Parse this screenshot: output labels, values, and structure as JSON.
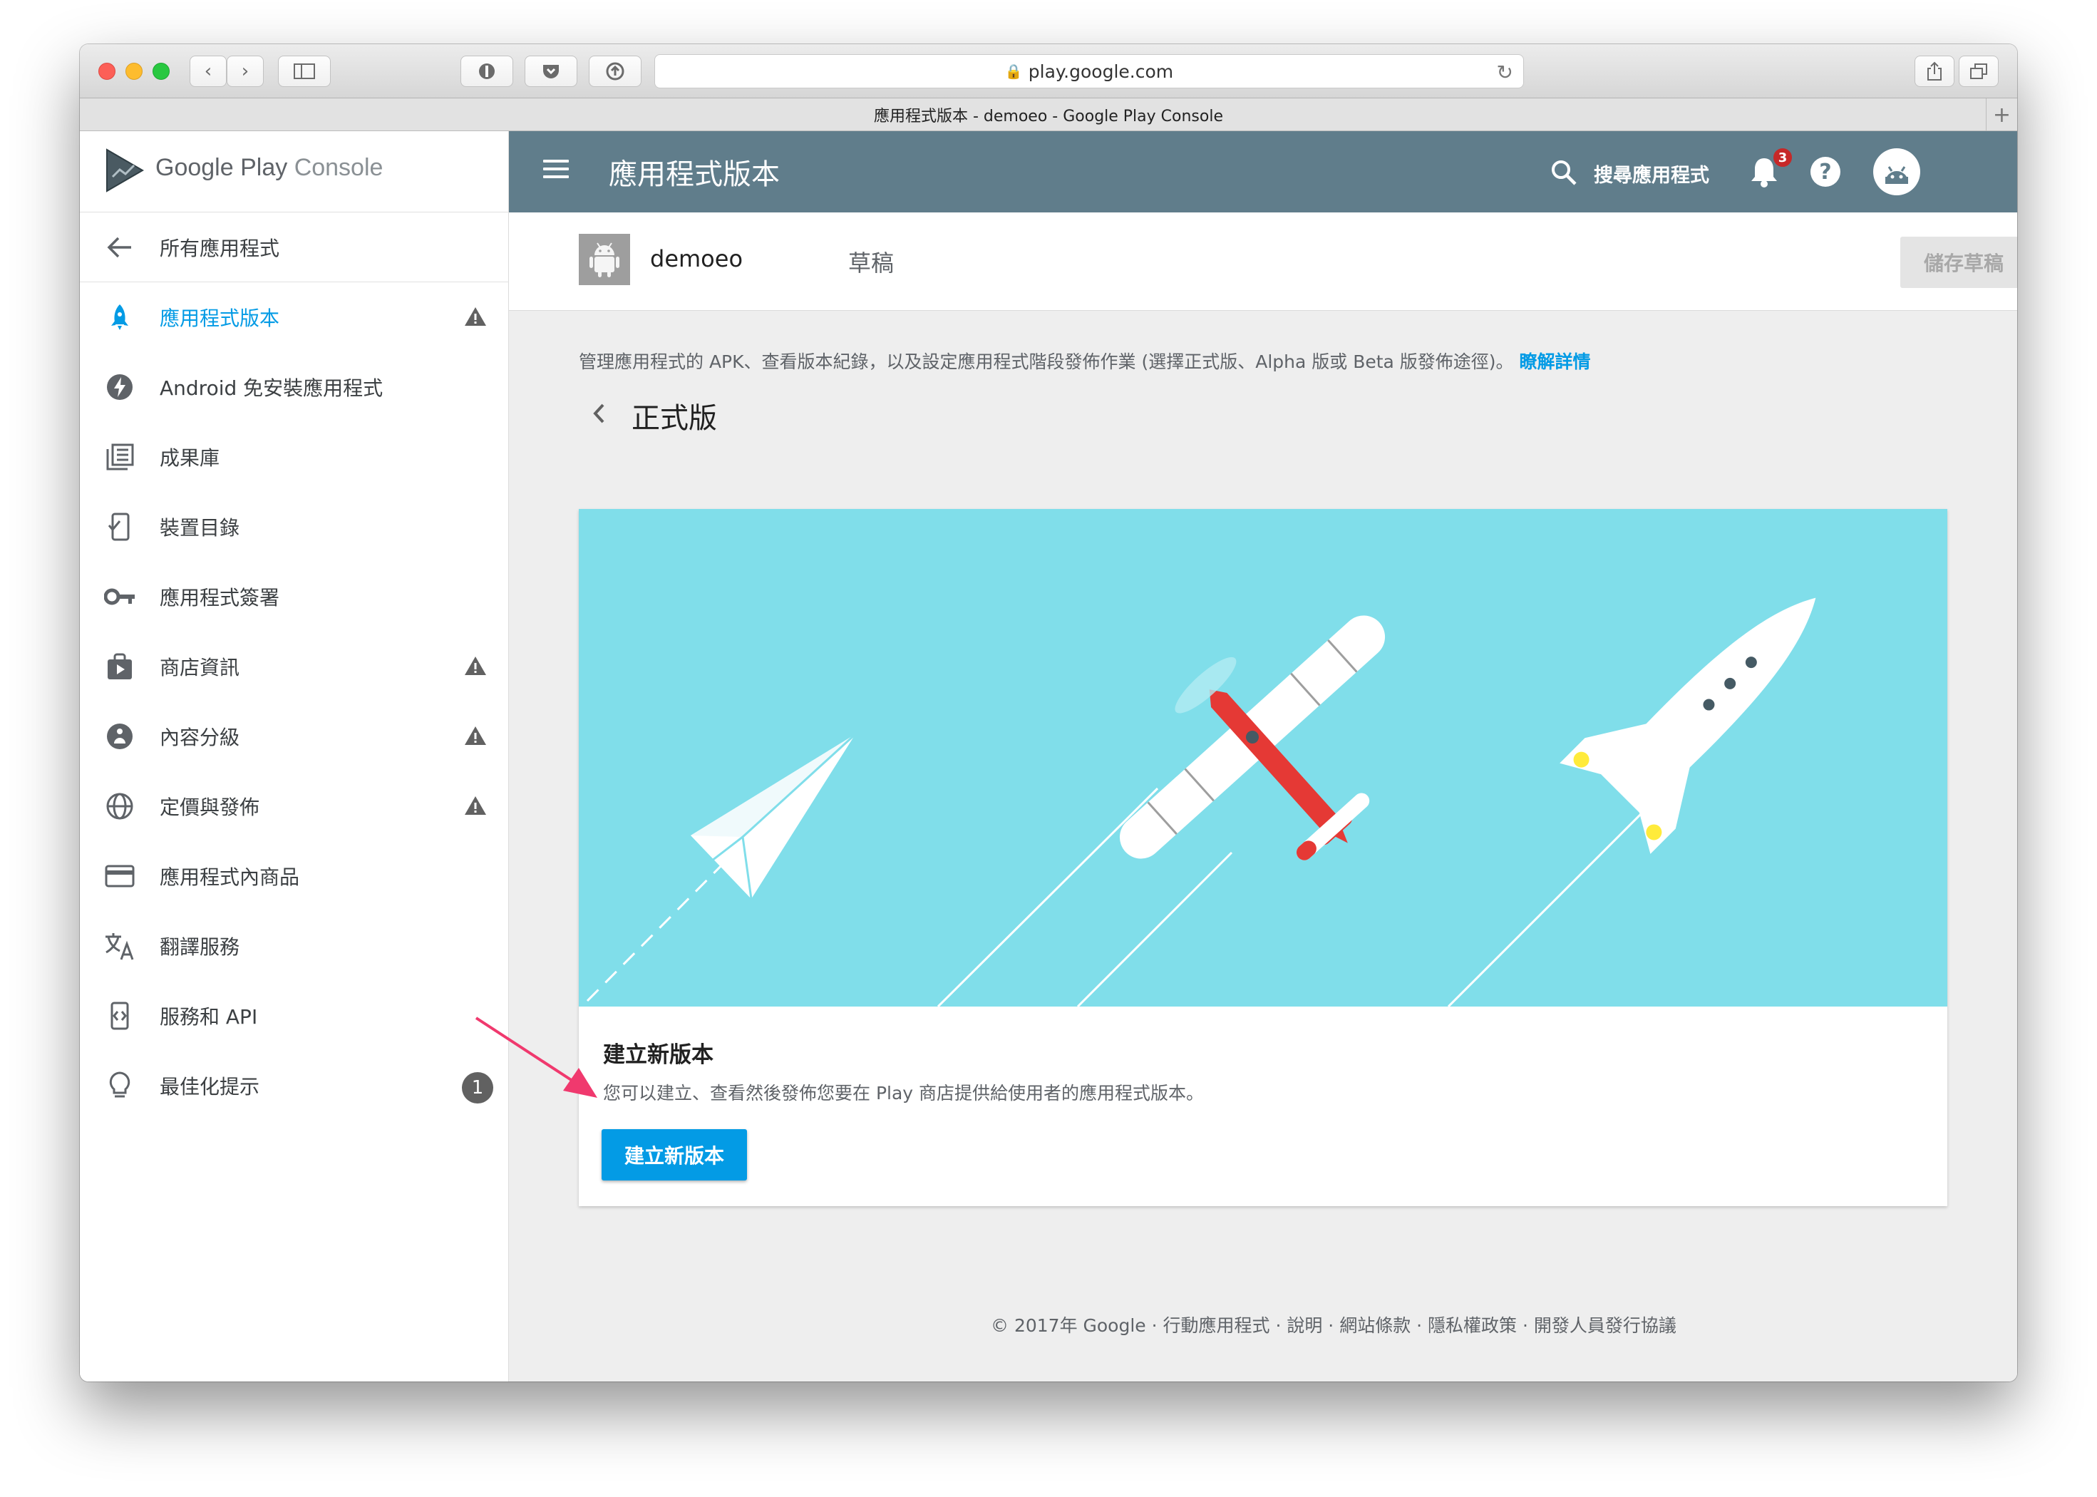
{
  "browser": {
    "url": "play.google.com",
    "tab_title": "應用程式版本 - demoeo - Google Play Console"
  },
  "sidebar": {
    "brand": {
      "name": "Google Play",
      "product": "Console"
    },
    "back_label": "所有應用程式",
    "items": [
      {
        "label": "應用程式版本",
        "icon": "rocket-icon",
        "active": true,
        "warning": true
      },
      {
        "label": "Android 免安裝應用程式",
        "icon": "lightning-icon",
        "warning": false
      },
      {
        "label": "成果庫",
        "icon": "library-icon",
        "warning": false
      },
      {
        "label": "裝置目錄",
        "icon": "device-catalog-icon",
        "warning": false
      },
      {
        "label": "應用程式簽署",
        "icon": "key-icon",
        "warning": false
      },
      {
        "label": "商店資訊",
        "icon": "store-listing-icon",
        "warning": true
      },
      {
        "label": "內容分級",
        "icon": "content-rating-icon",
        "warning": true
      },
      {
        "label": "定價與發佈",
        "icon": "globe-icon",
        "warning": true
      },
      {
        "label": "應用程式內商品",
        "icon": "credit-card-icon",
        "warning": false
      },
      {
        "label": "翻譯服務",
        "icon": "translate-icon",
        "warning": false
      },
      {
        "label": "服務和 API",
        "icon": "api-icon",
        "warning": false
      },
      {
        "label": "最佳化提示",
        "icon": "lightbulb-icon",
        "badge": "1"
      }
    ]
  },
  "appbar": {
    "title": "應用程式版本",
    "search_label": "搜尋應用程式",
    "notification_count": "3"
  },
  "subbar": {
    "app_name": "demoeo",
    "status": "草稿",
    "save_label": "儲存草稿"
  },
  "content": {
    "description": "管理應用程式的 APK、查看版本紀錄，以及設定應用程式階段發佈作業 (選擇正式版、Alpha 版或 Beta 版發佈途徑)。",
    "learn_more": "瞭解詳情",
    "section_title": "正式版",
    "card": {
      "title": "建立新版本",
      "description": "您可以建立、查看然後發佈您要在 Play 商店提供給使用者的應用程式版本。",
      "button_label": "建立新版本"
    }
  },
  "footer": "© 2017年 Google · 行動應用程式 · 說明 · 網站條款 · 隱私權政策 · 開發人員發行協議",
  "colors": {
    "appbar": "#607d8b",
    "accent": "#039be5",
    "hero_bg": "#80deea",
    "annotation_arrow": "#f0396e"
  }
}
